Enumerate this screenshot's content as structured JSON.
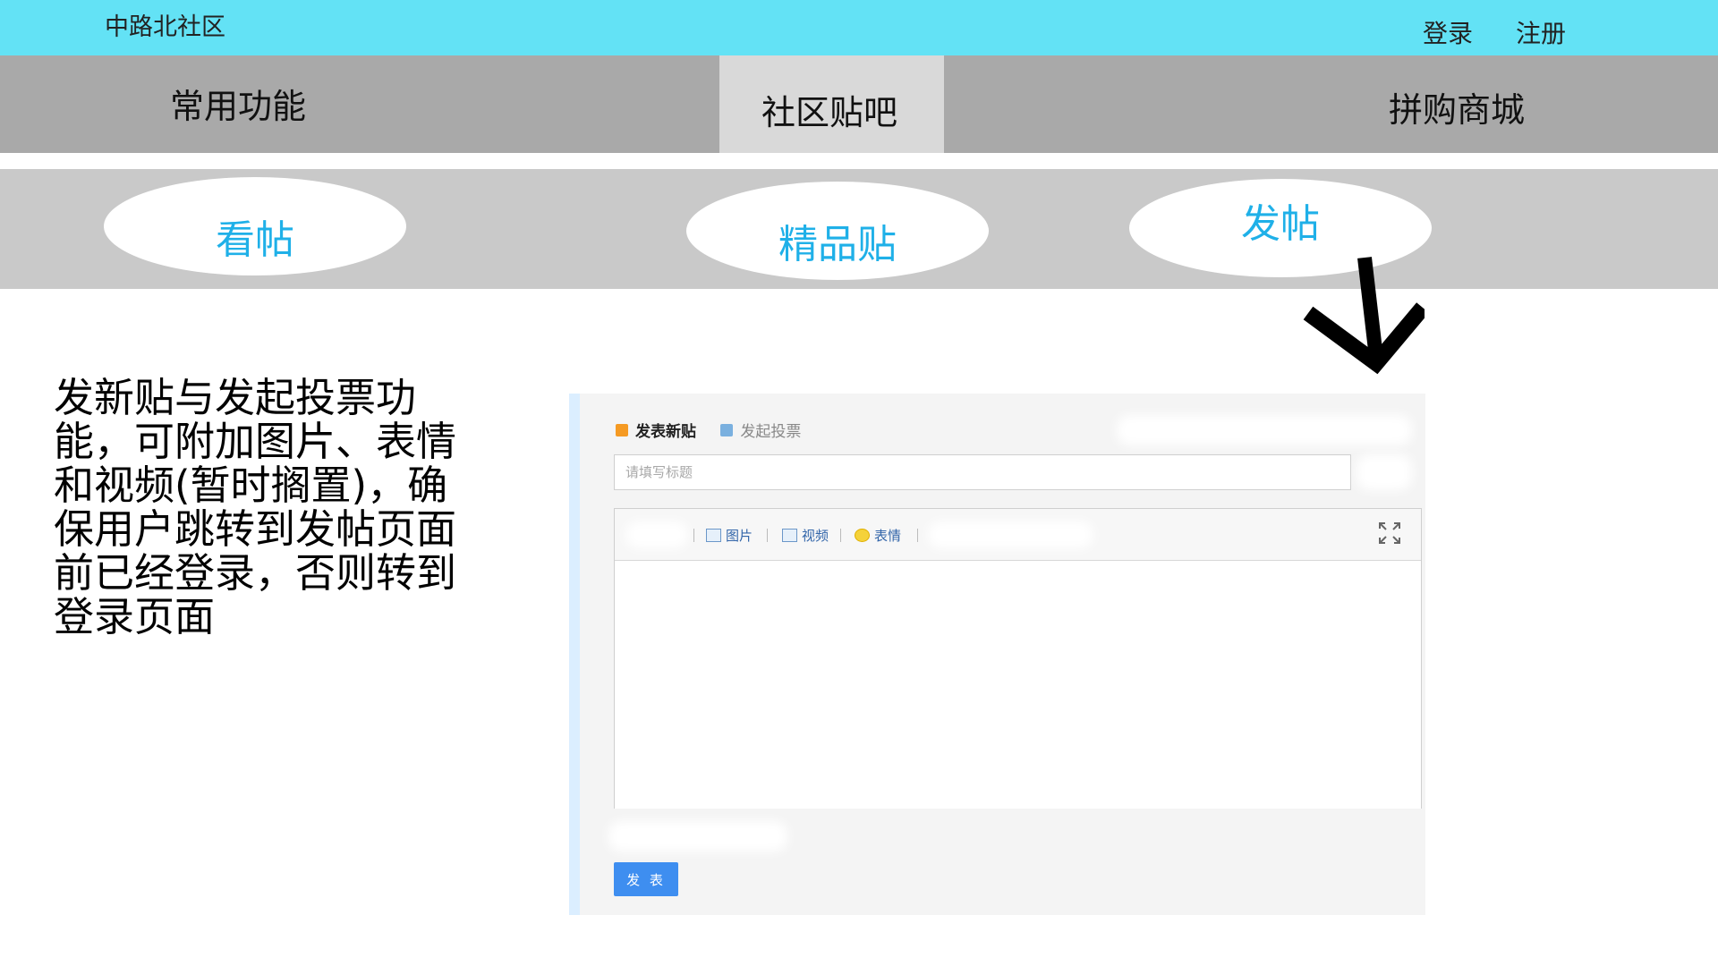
{
  "header": {
    "site_title": "中路北社区",
    "login": "登录",
    "register": "注册"
  },
  "main_nav": {
    "items": [
      "常用功能",
      "社区贴吧",
      "拼购商城"
    ],
    "active": "社区贴吧"
  },
  "sub_nav": {
    "items": [
      "看帖",
      "精品贴",
      "发帖"
    ]
  },
  "description": "发新贴与发起投票功能，可附加图片、表情和视频(暂时搁置)，确保用户跳转到发帖页面前已经登录，否则转到登录页面",
  "editor": {
    "tab_new_post": "发表新贴",
    "tab_vote": "发起投票",
    "title_placeholder": "请填写标题",
    "tool_image": "图片",
    "tool_video": "视频",
    "tool_emoji": "表情",
    "publish_button": "发 表"
  },
  "colors": {
    "topbar": "#63e2f5",
    "mainnav": "#a9a9a9",
    "mainnav_active": "#d9d9d9",
    "subnav": "#c9c9c9",
    "pill_text": "#1fb0e8",
    "publish_button": "#3e8ef0"
  }
}
